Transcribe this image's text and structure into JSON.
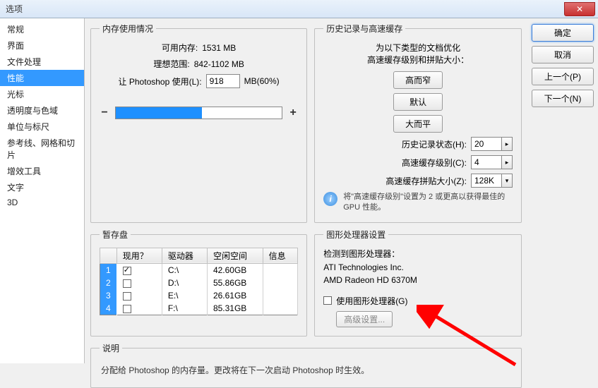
{
  "title": "选项",
  "close_glyph": "✕",
  "sidebar": {
    "items": [
      {
        "label": "常规"
      },
      {
        "label": "界面"
      },
      {
        "label": "文件处理"
      },
      {
        "label": "性能"
      },
      {
        "label": "光标"
      },
      {
        "label": "透明度与色域"
      },
      {
        "label": "单位与标尺"
      },
      {
        "label": "参考线、网格和切片"
      },
      {
        "label": "增效工具"
      },
      {
        "label": "文字"
      },
      {
        "label": "3D"
      }
    ],
    "selected_index": 3
  },
  "buttons": {
    "ok": "确定",
    "cancel": "取消",
    "prev": "上一个(P)",
    "next": "下一个(N)"
  },
  "memory": {
    "legend": "内存使用情况",
    "available_lbl": "可用内存:",
    "available_val": "1531 MB",
    "ideal_lbl": "理想范围:",
    "ideal_val": "842-1102 MB",
    "let_lbl": "让 Photoshop 使用(L):",
    "let_val": "918",
    "let_unit": "MB(60%)",
    "minus": "−",
    "plus": "+"
  },
  "history": {
    "legend": "历史记录与高速缓存",
    "optimize_line1": "为以下类型的文档优化",
    "optimize_line2": "高速缓存级别和拼贴大小：",
    "btn_tall": "高而窄",
    "btn_default": "默认",
    "btn_big": "大而平",
    "states_lbl": "历史记录状态(H):",
    "states_val": "20",
    "cache_lbl": "高速缓存级别(C):",
    "cache_val": "4",
    "tile_lbl": "高速缓存拼贴大小(Z):",
    "tile_val": "128K",
    "info_glyph": "i",
    "hint": "将\"高速缓存级别\"设置为 2 或更高以获得最佳的 GPU 性能。",
    "arrow_glyph": "▸",
    "dd_glyph": "▾"
  },
  "scratch": {
    "legend": "暂存盘",
    "hdr_active": "现用？",
    "hdr_drive": "驱动器",
    "hdr_free": "空闲空间",
    "hdr_info": "信息",
    "rows": [
      {
        "n": "1",
        "on": true,
        "drive": "C:\\",
        "free": "42.60GB"
      },
      {
        "n": "2",
        "on": false,
        "drive": "D:\\",
        "free": "55.86GB"
      },
      {
        "n": "3",
        "on": false,
        "drive": "E:\\",
        "free": "26.61GB"
      },
      {
        "n": "4",
        "on": false,
        "drive": "F:\\",
        "free": "85.31GB"
      }
    ]
  },
  "gpu": {
    "legend": "图形处理器设置",
    "detected_lbl": "检测到图形处理器：",
    "vendor": "ATI Technologies Inc.",
    "device": "AMD Radeon HD 6370M",
    "use_lbl": "使用图形处理器(G)",
    "adv_btn": "高级设置..."
  },
  "description": {
    "legend": "说明",
    "text": "分配给 Photoshop 的内存量。更改将在下一次启动 Photoshop 时生效。"
  }
}
